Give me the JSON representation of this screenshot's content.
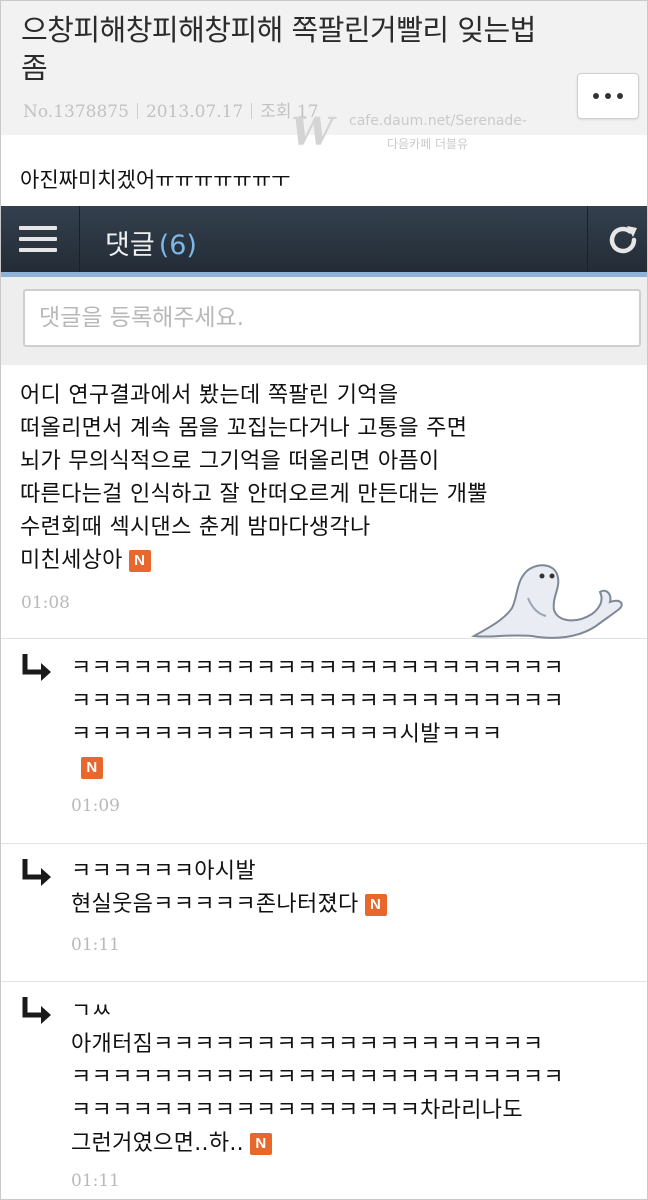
{
  "post": {
    "title": "으창피해창피해창피해 쪽팔린거빨리 잊는법좀",
    "no": "No.1378875",
    "date": "2013.07.17",
    "views": "조회 17",
    "body": "아진짜미치겠어ㅠㅠㅠㅠㅠㅠㅜ"
  },
  "watermark": {
    "logo": "W",
    "url": "cafe.daum.net/Serenade-",
    "sub": "다음카페 더블유"
  },
  "comment_bar": {
    "title": "댓글",
    "count": "(6)"
  },
  "comment_input": {
    "placeholder": "댓글을 등록해주세요."
  },
  "comments": [
    {
      "text": "어디 연구결과에서 봤는데 쪽팔린 기억을\n떠올리면서 계속 몸을 꼬집는다거나 고통을 주면\n뇌가 무의식적으로 그기억을 떠올리면 아픔이\n따른다는걸 인식하고 잘 안떠오르게 만든대는 개뿔\n수련회때 섹시댄스 춘게 밤마다생각나\n미친세상아",
      "badge": "N",
      "time": "01:08",
      "emoticon": "seal-emoticon"
    },
    {
      "text": "ㅋㅋㅋㅋㅋㅋㅋㅋㅋㅋㅋㅋㅋㅋㅋㅋㅋㅋㅋㅋㅋㅋㅋㅋ\nㅋㅋㅋㅋㅋㅋㅋㅋㅋㅋㅋㅋㅋㅋㅋㅋㅋㅋㅋㅋㅋㅋㅋㅋ\nㅋㅋㅋㅋㅋㅋㅋㅋㅋㅋㅋㅋㅋㅋㅋㅋ시발ㅋㅋㅋ",
      "badge": "N",
      "time": "01:09"
    },
    {
      "text": "ㅋㅋㅋㅋㅋㅋ아시발\n현실웃음ㅋㅋㅋㅋㅋ존나터졌다",
      "badge": "N",
      "time": "01:11"
    },
    {
      "text": "ㄱㅆ\n아개터짐ㅋㅋㅋㅋㅋㅋㅋㅋㅋㅋㅋㅋㅋㅋㅋㅋㅋㅋㅋ\nㅋㅋㅋㅋㅋㅋㅋㅋㅋㅋㅋㅋㅋㅋㅋㅋㅋㅋㅋㅋㅋㅋㅋㅋ\nㅋㅋㅋㅋㅋㅋㅋㅋㅋㅋㅋㅋㅋㅋㅋㅋㅋ차라리나도\n그런거였으면..하..",
      "badge": "N",
      "time": "01:11"
    }
  ],
  "colors": {
    "bar": "#2b3440",
    "bar_accent": "#8fb3d6",
    "count": "#7db7e6",
    "badge": "#e8672c"
  }
}
